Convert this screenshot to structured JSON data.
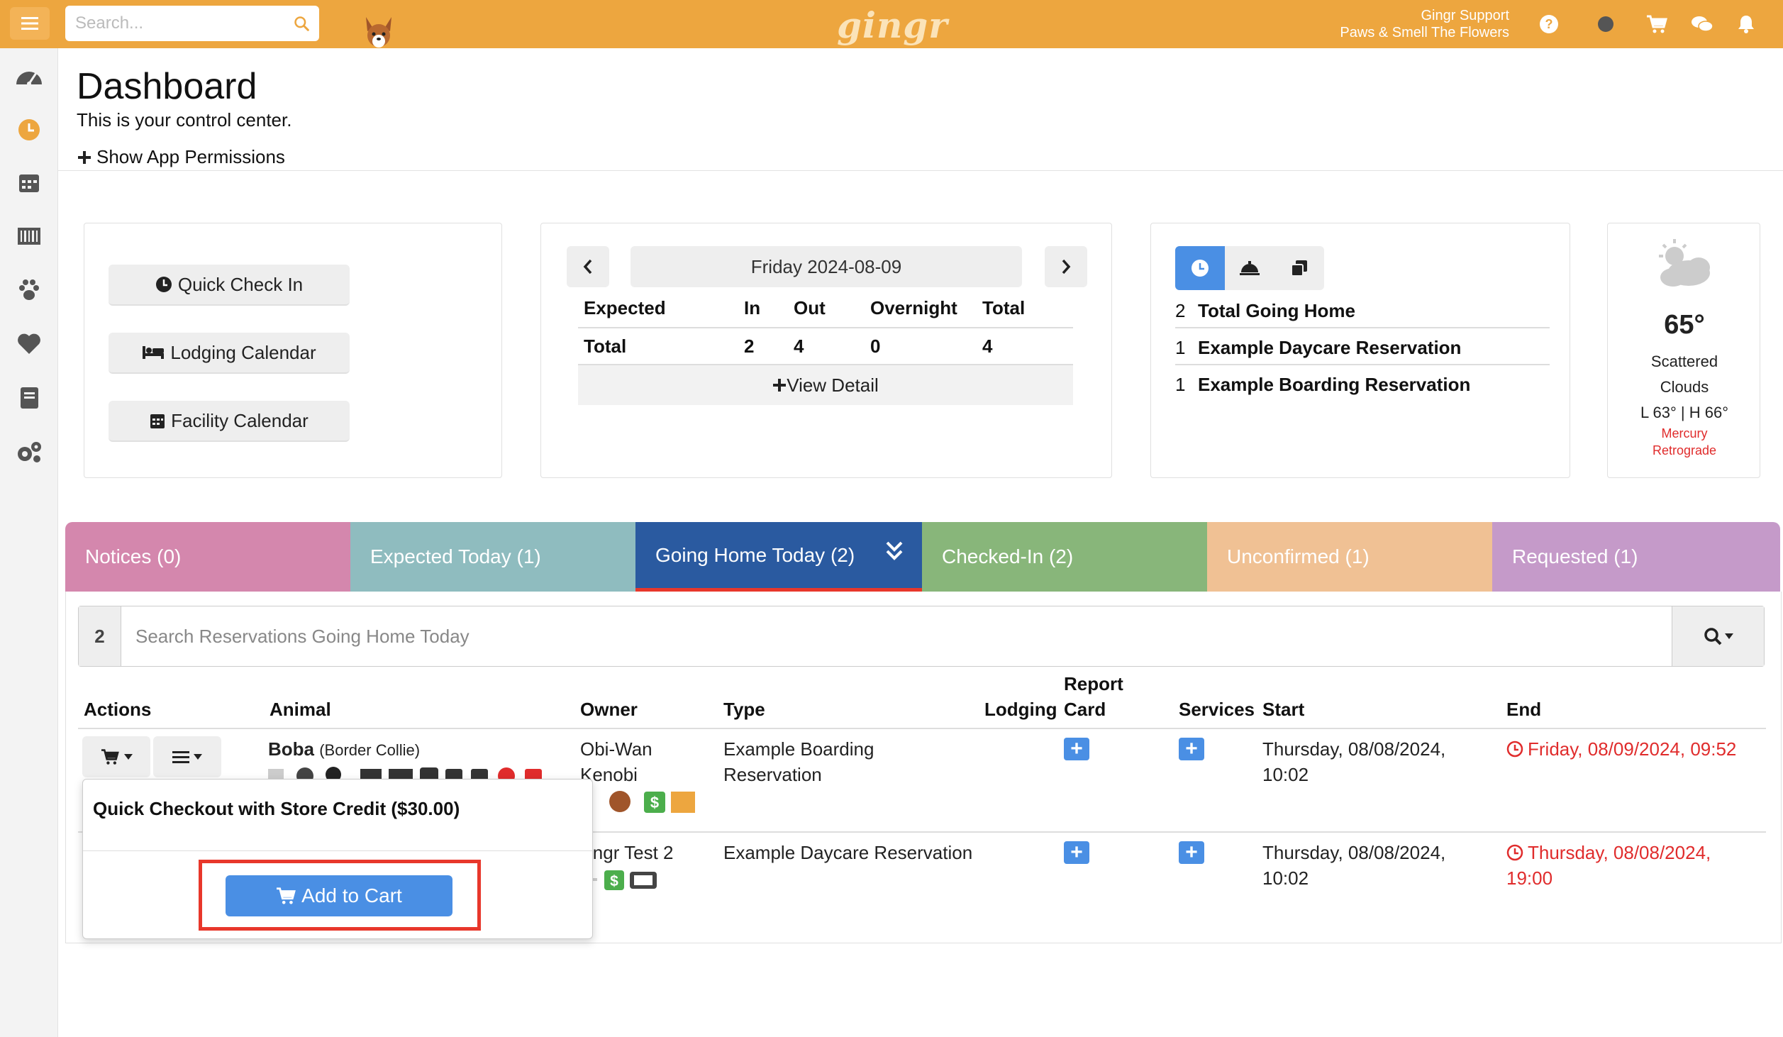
{
  "topbar": {
    "search_placeholder": "Search...",
    "brand": "gingr",
    "user_name": "Gingr Support",
    "location": "Paws & Smell The Flowers",
    "color": "#eda63f"
  },
  "sidebar": {
    "items": [
      "dashboard",
      "clock",
      "calendar",
      "barcode",
      "paw",
      "heart",
      "book",
      "settings"
    ]
  },
  "header": {
    "title": "Dashboard",
    "subtitle": "This is your control center.",
    "permissions_link": "Show App Permissions"
  },
  "quick_actions": {
    "check_in": "Quick Check In",
    "lodging": "Lodging Calendar",
    "facility": "Facility Calendar"
  },
  "date_card": {
    "date": "Friday 2024-08-09",
    "headers": [
      "Expected",
      "In",
      "Out",
      "Overnight",
      "Total"
    ],
    "row_label": "Total",
    "in": "2",
    "out": "4",
    "overnight": "0",
    "total": "4",
    "view_detail": "View Detail"
  },
  "going_home_card": {
    "rows": [
      {
        "count": "2",
        "label": "Total Going Home"
      },
      {
        "count": "1",
        "label": "Example Daycare Reservation"
      },
      {
        "count": "1",
        "label": "Example Boarding Reservation"
      }
    ]
  },
  "weather": {
    "temp": "65°",
    "desc1": "Scattered",
    "desc2": "Clouds",
    "range": "L 63° | H 66°",
    "note1": "Mercury",
    "note2": "Retrograde"
  },
  "tabs": [
    {
      "label": "Notices (0)",
      "color": "#d487ad"
    },
    {
      "label": "Expected Today (1)",
      "color": "#8fbcbf"
    },
    {
      "label": "Going Home Today (2)",
      "color": "#2a5aa0"
    },
    {
      "label": "Checked-In (2)",
      "color": "#88b67a"
    },
    {
      "label": "Unconfirmed (1)",
      "color": "#f0c194"
    },
    {
      "label": "Requested (1)",
      "color": "#c59ac9"
    }
  ],
  "reservations": {
    "count": "2",
    "search_placeholder": "Search Reservations Going Home Today",
    "columns": {
      "actions": "Actions",
      "animal": "Animal",
      "owner": "Owner",
      "type": "Type",
      "lodging": "Lodging",
      "report_card_1": "Report",
      "report_card_2": "Card",
      "services": "Services",
      "start": "Start",
      "end": "End"
    },
    "rows": [
      {
        "animal_name": "Boba",
        "animal_breed": "(Border Collie)",
        "owner_1": "Obi-Wan",
        "owner_2": "Kenobi",
        "type_1": "Example Boarding",
        "type_2": "Reservation",
        "start_1": "Thursday, 08/08/2024,",
        "start_2": "10:02",
        "end_1": "Friday, 08/09/2024, 09:52",
        "end_2": ""
      },
      {
        "owner_1": "ingr Test 2",
        "type_1": "Example Daycare Reservation",
        "start_1": "Thursday, 08/08/2024,",
        "start_2": "10:02",
        "end_1": "Thursday, 08/08/2024,",
        "end_2": "19:00"
      }
    ]
  },
  "popover": {
    "title": "Quick Checkout with Store Credit ($30.00)",
    "button": "Add to Cart"
  }
}
